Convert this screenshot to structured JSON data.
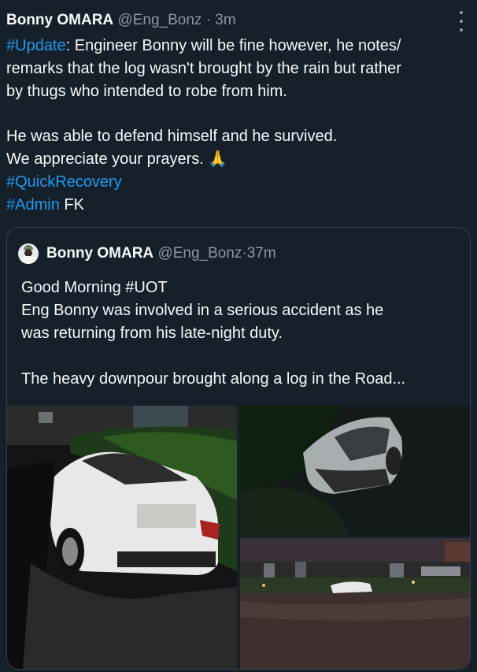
{
  "tweet": {
    "author_name": "Bonny OMARA",
    "author_handle": "@Eng_Bonz",
    "time_sep": " · ",
    "time": "3m",
    "lines": [
      {
        "tag": "#Update",
        "text": ": Engineer Bonny will be fine however, he notes/"
      },
      {
        "text": "remarks that the log wasn't brought by the rain but rather"
      },
      {
        "text": "by thugs who intended to robe from him."
      },
      {
        "text": "He was able to defend himself and he survived."
      },
      {
        "text": "We appreciate your prayers. 🙏"
      },
      {
        "tag": "#QuickRecovery"
      },
      {
        "tag": "#Admin",
        "text": " FK"
      }
    ]
  },
  "quoted": {
    "author_name": "Bonny OMARA",
    "author_handle": "@Eng_Bonz",
    "time_sep": " · ",
    "time": "37m",
    "lines": [
      "Good Morning #UOT",
      "Eng Bonny was involved in a serious accident as he",
      "was returning from his late-night duty.",
      "The heavy downpour brought along a log in the Road..."
    ]
  },
  "icons": {
    "more": "more-options-icon",
    "avatar": "avatar-image"
  },
  "colors": {
    "background": "#15202b",
    "text": "#f7f9f9",
    "muted": "#8b98a5",
    "link": "#1d9bf0",
    "border": "#38444d"
  }
}
